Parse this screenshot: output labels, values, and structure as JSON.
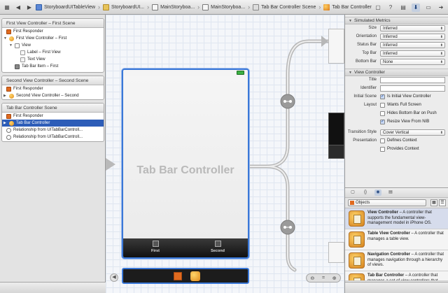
{
  "jumpbar": {
    "crumbs": [
      "StoryboardUITableView",
      "StoryboardUI...",
      "MainStoryboa...",
      "MainStoryboa...",
      "Tab Bar Controller Scene",
      "Tab Bar Controller"
    ]
  },
  "outline": {
    "sections": [
      {
        "title": "First View Controller – First Scene",
        "rows": [
          "First Responder",
          "First View Controller – First",
          "View",
          "Label – First View",
          "Text View",
          "Tab Bar Item – First"
        ]
      },
      {
        "title": "Second View Controller – Second Scene",
        "rows": [
          "First Responder",
          "Second View Controller – Second"
        ]
      },
      {
        "title": "Tab Bar Controller Scene",
        "rows": [
          "First Responder",
          "Tab Bar Controller",
          "Relationship from UITabBarControll...",
          "Relationship from UITabBarControll..."
        ]
      }
    ]
  },
  "canvas": {
    "controller_title": "Tab Bar Controller",
    "tabs": [
      "First",
      "Second"
    ]
  },
  "inspector": {
    "simulated_metrics": {
      "title": "Simulated Metrics",
      "fields": [
        {
          "label": "Size",
          "value": "Inferred"
        },
        {
          "label": "Orientation",
          "value": "Inferred"
        },
        {
          "label": "Status Bar",
          "value": "Inferred"
        },
        {
          "label": "Top Bar",
          "value": "Inferred"
        },
        {
          "label": "Bottom Bar",
          "value": "None"
        }
      ]
    },
    "view_controller": {
      "title": "View Controller",
      "title_label": "Title",
      "identifier_label": "Identifier",
      "initial_scene_label": "Initial Scene",
      "initial_scene_option": "Is Initial View Controller",
      "layout_label": "Layout",
      "layout_options": [
        "Wants Full Screen",
        "Hides Bottom Bar on Push",
        "Resize View From NIB"
      ],
      "transition_label": "Transition Style",
      "transition_value": "Cover Vertical",
      "presentation_label": "Presentation",
      "presentation_options": [
        "Defines Context",
        "Provides Context"
      ]
    },
    "library": {
      "selector": "Objects",
      "items": [
        {
          "name": "View Controller",
          "desc": " – A controller that supports the fundamental view-management model in iPhone OS."
        },
        {
          "name": "Table View Controller",
          "desc": " – A controller that manages a table view."
        },
        {
          "name": "Navigation Controller",
          "desc": " – A controller that manages navigation through a hierarchy of views."
        },
        {
          "name": "Tab Bar Controller",
          "desc": " – A controller that manages a set of view controllers that"
        }
      ]
    }
  }
}
